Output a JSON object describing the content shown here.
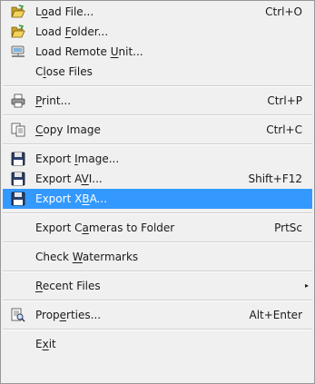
{
  "menu": {
    "load_file": {
      "pre": "L",
      "u": "o",
      "post": "ad File...",
      "shortcut": "Ctrl+O",
      "icon": "open-folder-icon"
    },
    "load_folder": {
      "pre": "Load ",
      "u": "F",
      "post": "older...",
      "icon": "open-folder-icon"
    },
    "load_remote": {
      "pre": "Load Remote ",
      "u": "U",
      "post": "nit...",
      "icon": "remote-computer-icon"
    },
    "close_files": {
      "pre": "C",
      "u": "l",
      "post": "ose Files"
    },
    "print": {
      "pre": "",
      "u": "P",
      "post": "rint...",
      "shortcut": "Ctrl+P",
      "icon": "printer-icon"
    },
    "copy_image": {
      "pre": "",
      "u": "C",
      "post": "opy Image",
      "shortcut": "Ctrl+C",
      "icon": "copy-icon"
    },
    "export_image": {
      "pre": "Export ",
      "u": "I",
      "post": "mage...",
      "icon": "floppy-disk-icon"
    },
    "export_avi": {
      "pre": "Export A",
      "u": "V",
      "post": "I...",
      "shortcut": "Shift+F12",
      "icon": "floppy-disk-icon"
    },
    "export_xba": {
      "pre": "Export X",
      "u": "B",
      "post": "A...",
      "icon": "floppy-disk-icon"
    },
    "export_cameras": {
      "pre": "Export C",
      "u": "a",
      "post": "meras to Folder",
      "shortcut": "PrtSc"
    },
    "check_watermarks": {
      "pre": "Check ",
      "u": "W",
      "post": "atermarks"
    },
    "recent_files": {
      "pre": "",
      "u": "R",
      "post": "ecent Files",
      "submenu_arrow": "▸"
    },
    "properties": {
      "pre": "Prop",
      "u": "e",
      "post": "rties...",
      "shortcut": "Alt+Enter",
      "icon": "properties-icon"
    },
    "exit": {
      "pre": "E",
      "u": "x",
      "post": "it"
    }
  },
  "colors": {
    "menu_background": "#f0f0f0",
    "highlight": "#3399ff",
    "highlight_text": "#ffffff",
    "separator": "#cfcfcf"
  },
  "highlighted_item": "export_xba"
}
